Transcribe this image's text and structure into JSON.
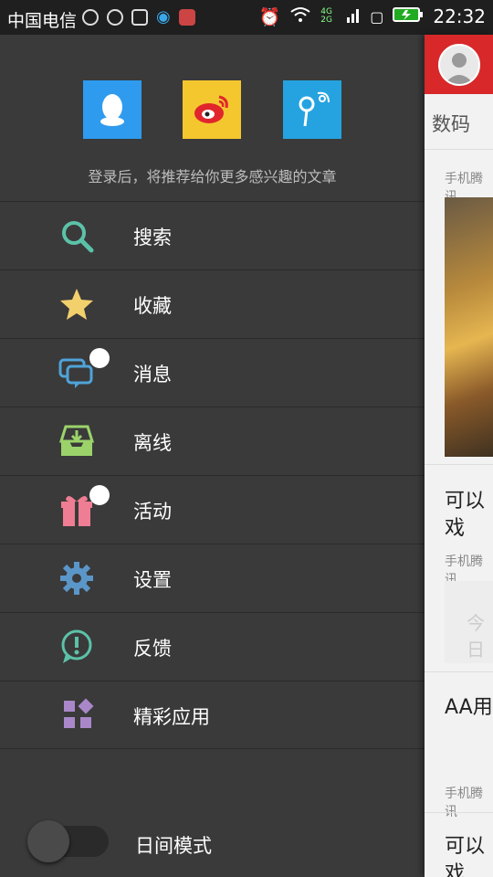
{
  "status_bar": {
    "carrier": "中国电信",
    "time": "22:32",
    "network": "4G 2G"
  },
  "drawer": {
    "login_hint": "登录后，将推荐给你更多感兴趣的文章",
    "social": [
      {
        "name": "qq-login"
      },
      {
        "name": "weibo-login"
      },
      {
        "name": "tencent-weibo-login"
      }
    ],
    "menu": [
      {
        "label": "搜索",
        "icon": "search-icon",
        "color": "#5bc2a8"
      },
      {
        "label": "收藏",
        "icon": "star-icon",
        "color": "#f2d06b"
      },
      {
        "label": "消息",
        "icon": "message-icon",
        "color": "#4fa3d8"
      },
      {
        "label": "离线",
        "icon": "download-box-icon",
        "color": "#9bd36a"
      },
      {
        "label": "活动",
        "icon": "gift-icon",
        "color": "#ef7d93"
      },
      {
        "label": "设置",
        "icon": "gear-icon",
        "color": "#5b96c9"
      },
      {
        "label": "反馈",
        "icon": "feedback-icon",
        "color": "#5bc2a8"
      },
      {
        "label": "精彩应用",
        "icon": "apps-icon",
        "color": "#a987c9"
      }
    ],
    "day_mode": {
      "label": "日间模式",
      "enabled": false
    }
  },
  "content": {
    "tab": "数码",
    "cards": [
      {
        "title": "可以",
        "title2": "戏",
        "meta": "手机腾讯"
      },
      {
        "title": "AA用",
        "meta": "手机腾讯"
      },
      {
        "title": "可以",
        "title2": "戏"
      }
    ],
    "top_meta": "手机腾讯",
    "gray_text": "今日"
  }
}
